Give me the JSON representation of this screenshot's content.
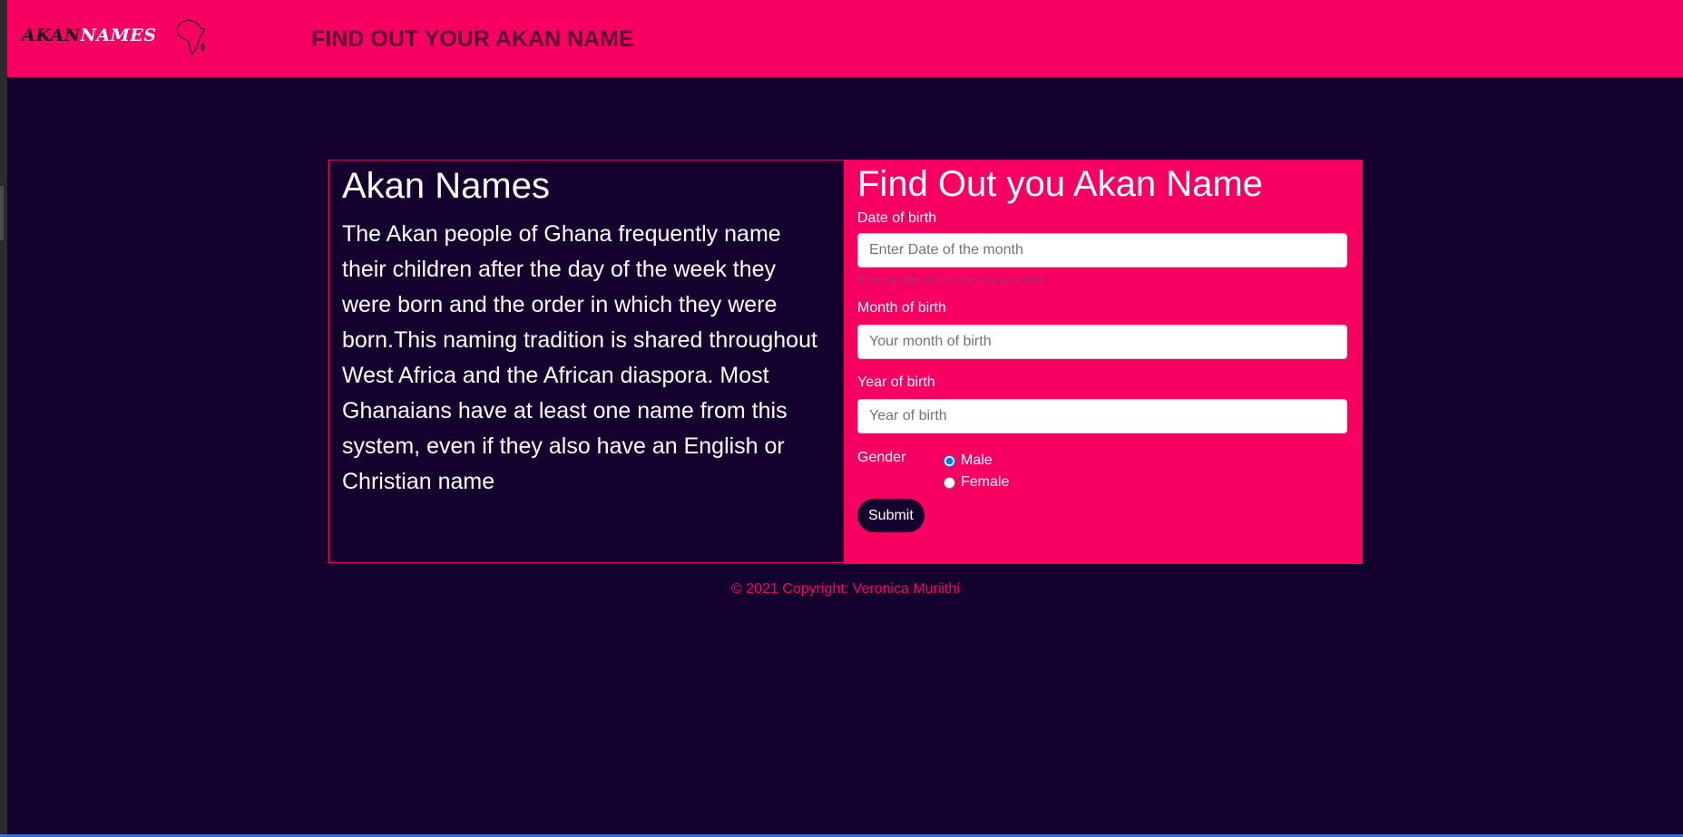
{
  "header": {
    "brand_akan": "AKAN",
    "brand_names": "NAMES",
    "title": "FIND OUT YOUR AKAN NAME"
  },
  "info": {
    "heading": "Akan Names",
    "body": "The Akan people of Ghana frequently name their children after the day of the week they were born and the order in which they were born.This naming tradition is shared throughout West Africa and the African diaspora. Most Ghanaians have at least one name from this system, even if they also have an English or Christian name"
  },
  "form": {
    "heading": "Find Out you Akan Name",
    "date_label": "Date of birth",
    "date_placeholder": "Enter Date of the month",
    "date_help": "Enter the date of the month you were born",
    "month_label": "Month of birth",
    "month_placeholder": "Your month of birth",
    "year_label": "Year of birth",
    "year_placeholder": "Year of birth",
    "gender_label": "Gender",
    "gender_options": [
      "Male",
      "Female"
    ],
    "gender_selected": "Male",
    "submit_label": "Submit"
  },
  "footer": {
    "text": "© 2021 Copyright: Veronica Muriithi"
  },
  "colors": {
    "accent": "#f70062",
    "background": "#15012e"
  },
  "icons": {
    "logo": "africa-outline-icon"
  }
}
